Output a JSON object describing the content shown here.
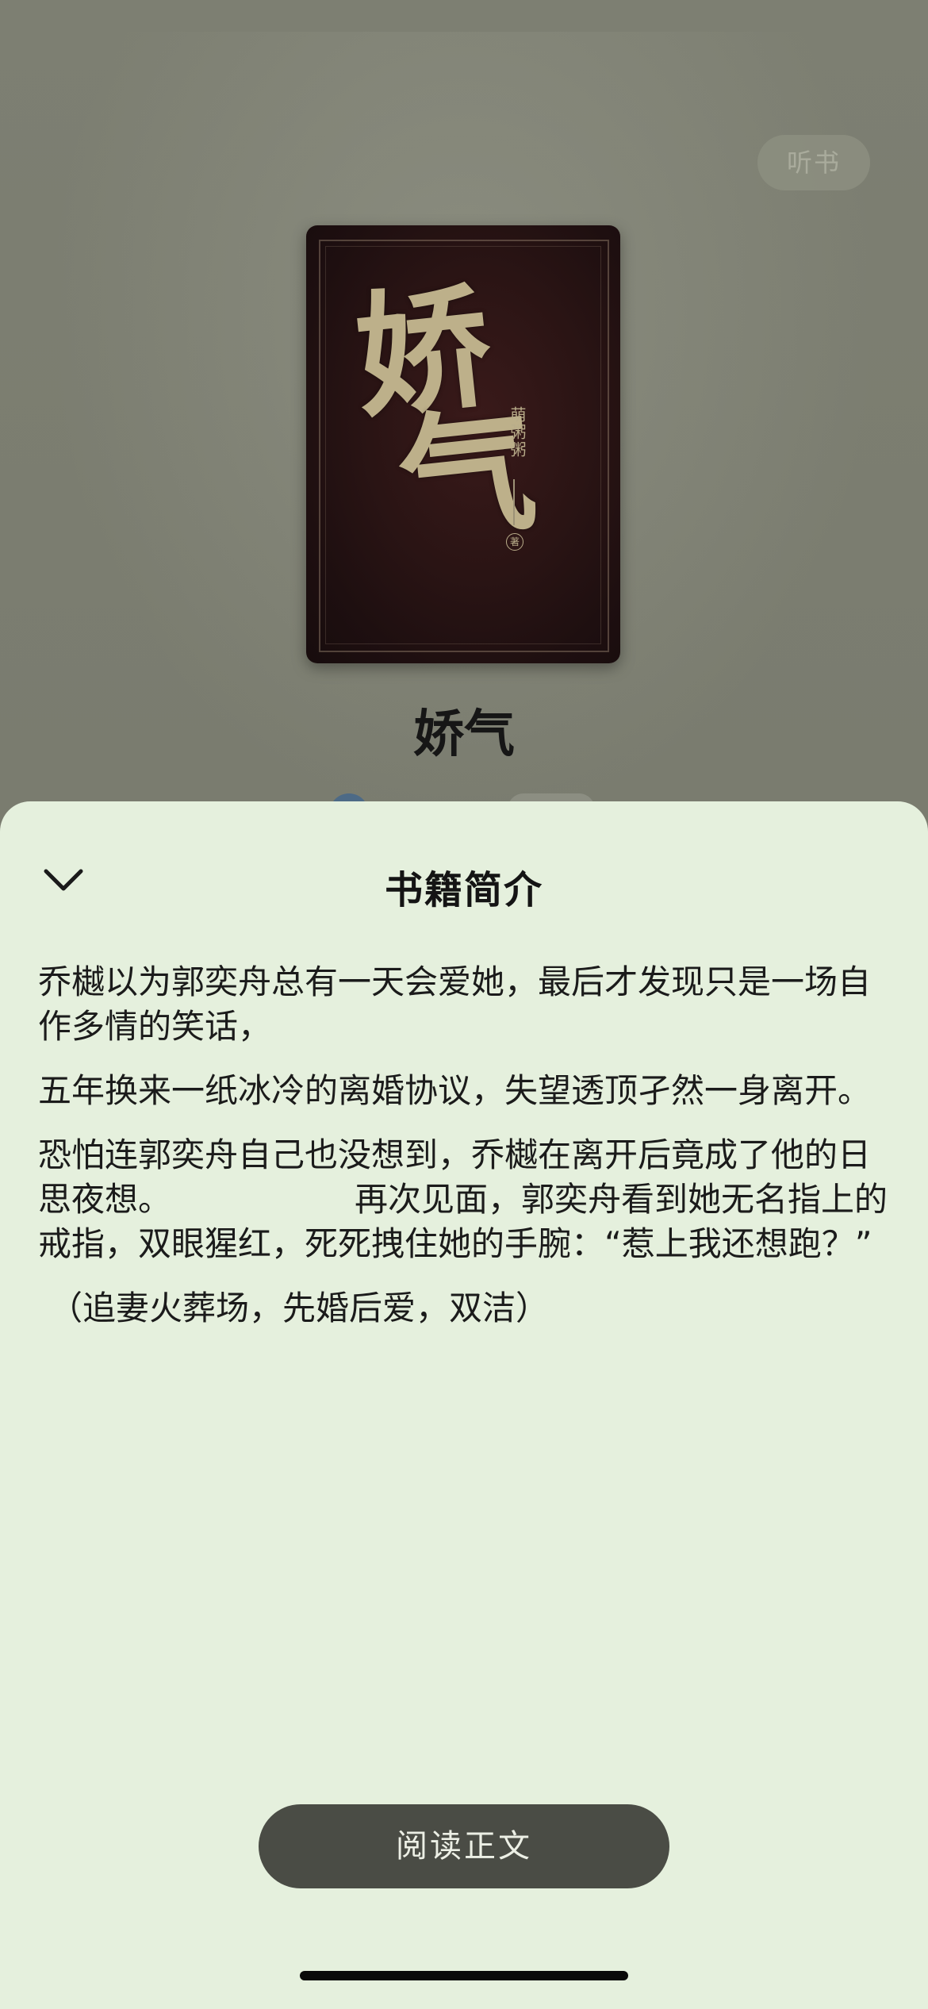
{
  "header": {
    "listen_label": "听书"
  },
  "book": {
    "cover_title_char1": "娇",
    "cover_title_char2": "气",
    "cover_author": "萌粥粥",
    "cover_seal": "著",
    "title": "娇气"
  },
  "sheet": {
    "title": "书籍简介",
    "paragraphs": [
      "乔樾以为郭奕舟总有一天会爱她，最后才发现只是一场自作多情的笑话，",
      "五年换来一纸冰冷的离婚协议，失望透顶孑然一身离开。",
      "恐怕连郭奕舟自己也没想到，乔樾在离开后竟成了他的日思夜想。　　　　　　再次见面，郭奕舟看到她无名指上的戒指，双眼猩红，死死拽住她的手腕：“惹上我还想跑？”",
      "（追妻火葬场，先婚后爱，双洁）"
    ],
    "read_button_label": "阅读正文"
  },
  "colors": {
    "sheet_background": "#e5f0dd",
    "backdrop": "#7b7d70",
    "button": "#4a4c45"
  },
  "icons": {
    "collapse": "chevron-down-icon"
  }
}
